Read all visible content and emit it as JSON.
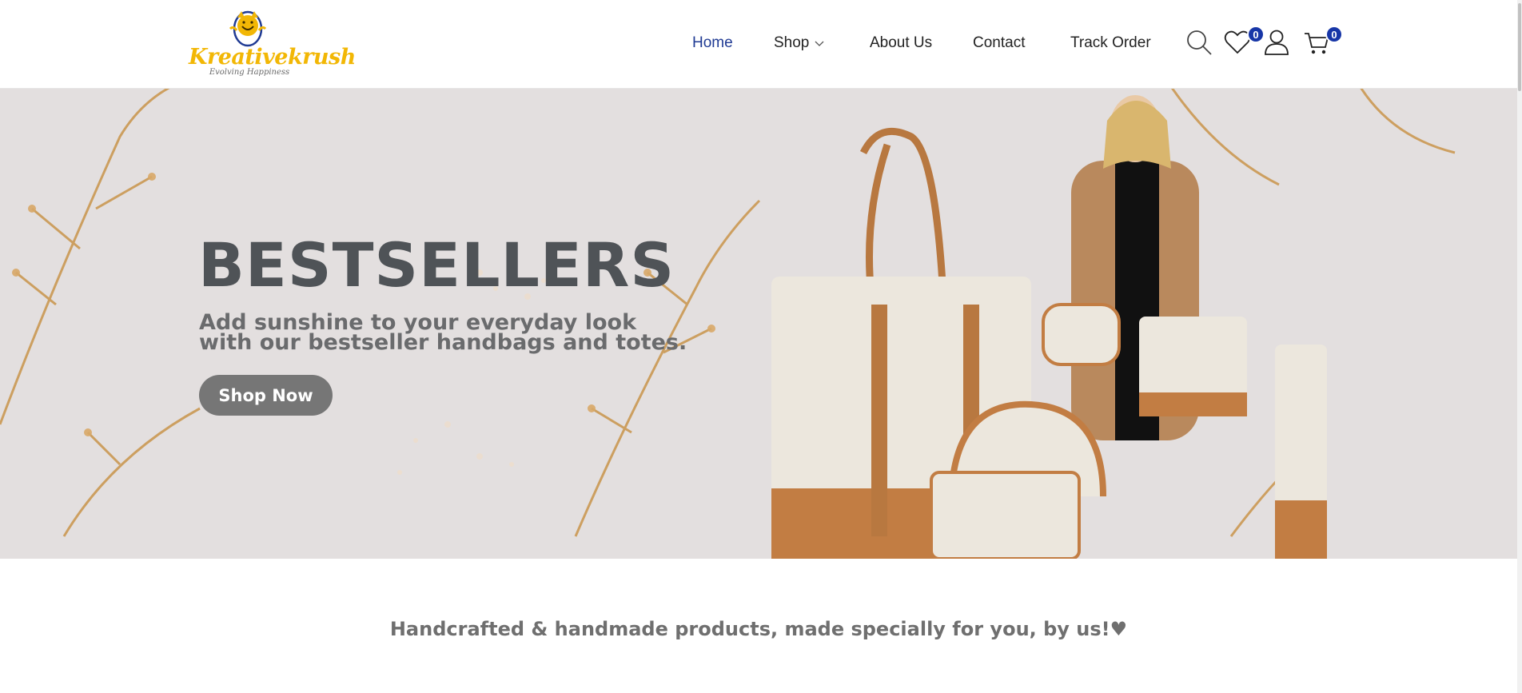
{
  "brand": {
    "name": "Kreativekrush",
    "tagline": "Evolving Happiness"
  },
  "nav": {
    "items": [
      {
        "label": "Home",
        "active": true
      },
      {
        "label": "Shop",
        "has_dropdown": true
      },
      {
        "label": "About Us"
      },
      {
        "label": "Contact"
      },
      {
        "label": "Track Order"
      }
    ]
  },
  "header_icons": {
    "search": "search-icon",
    "wishlist": "heart-icon",
    "account": "user-icon",
    "cart": "cart-icon",
    "wishlist_count": "0",
    "cart_count": "0"
  },
  "hero": {
    "title": "BESTSELLERS",
    "subtitle": "Add sunshine to your everyday look with our bestseller handbags and totes.",
    "button_label": "Shop Now"
  },
  "tagline": "Handcrafted & handmade products, made specially for you, by us!♥",
  "colors": {
    "accent": "#1f3a93",
    "badge": "#1736a7",
    "logo_yellow": "#f2b705",
    "hero_bg": "#e3dfdf",
    "button": "#767676"
  }
}
